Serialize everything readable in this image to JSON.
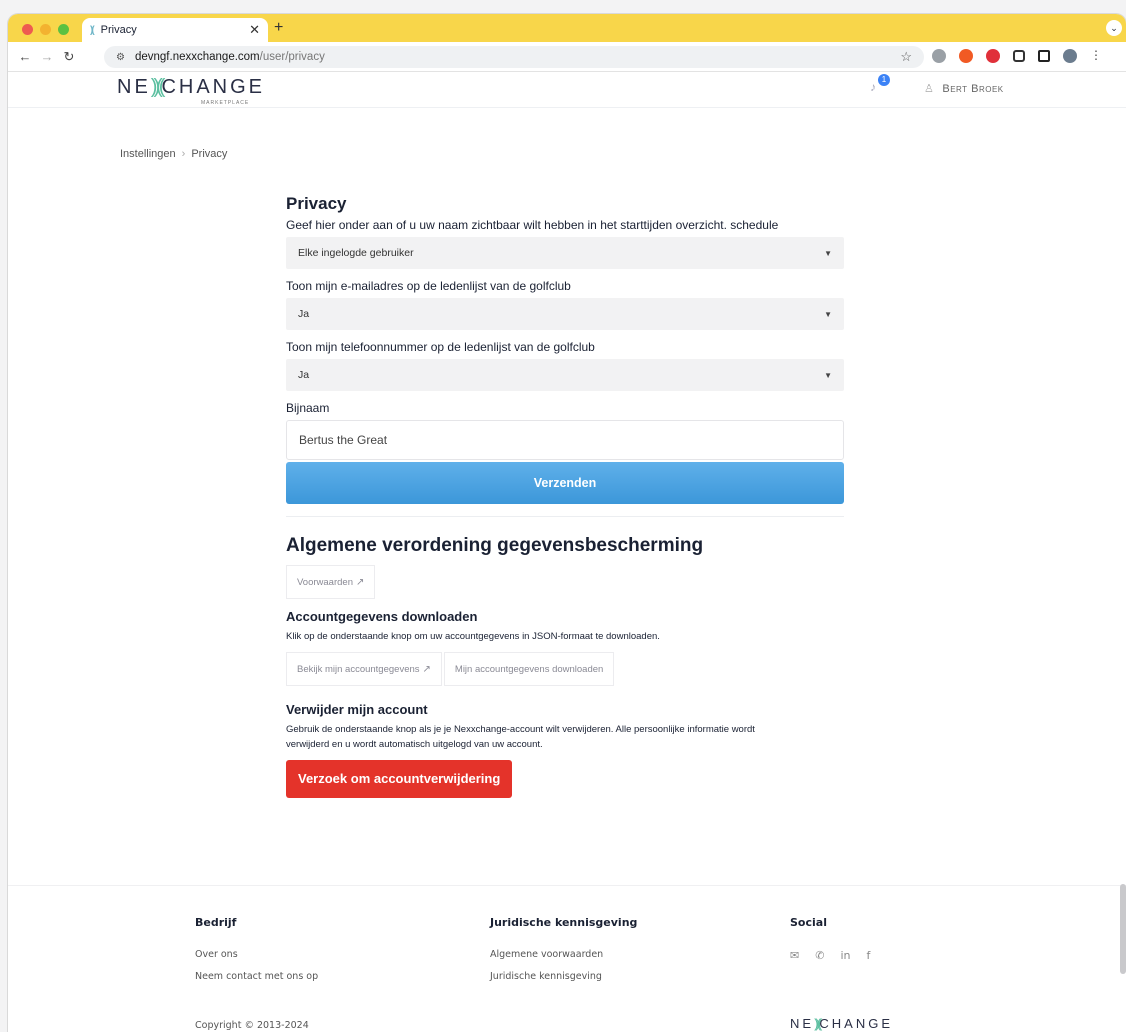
{
  "browser": {
    "tab_title": "Privacy",
    "url_host": "devngf.nexxchange.com",
    "url_path": "/user/privacy"
  },
  "header": {
    "logo_left": "NE",
    "logo_mark": "))((",
    "logo_right": "CHANGE",
    "logo_sub": "MARKETPLACE",
    "notification_count": "1",
    "user_name": "Bert Broek"
  },
  "breadcrumb": {
    "parent": "Instellingen",
    "current": "Privacy"
  },
  "form": {
    "title": "Privacy",
    "name_visibility_label": "Geef hier onder aan of u uw naam zichtbaar wilt hebben in het starttijden overzicht. schedule",
    "name_visibility_value": "Elke ingelogde gebruiker",
    "email_label": "Toon mijn e-mailadres op de ledenlijst van de golfclub",
    "email_value": "Ja",
    "phone_label": "Toon mijn telefoonnummer op de ledenlijst van de golfclub",
    "phone_value": "Ja",
    "nickname_label": "Bijnaam",
    "nickname_value": "Bertus the Great",
    "submit_label": "Verzenden"
  },
  "gdpr": {
    "title": "Algemene verordening gegevensbescherming",
    "terms_button": "Voorwaarden",
    "download_title": "Accountgegevens downloaden",
    "download_desc": "Klik op de onderstaande knop om uw accountgegevens in JSON-formaat te downloaden.",
    "view_button": "Bekijk mijn accountgegevens",
    "download_button": "Mijn accountgegevens downloaden",
    "delete_title": "Verwijder mijn account",
    "delete_desc_1": "Gebruik de onderstaande knop als je je Nexxchange-account wilt verwijderen. Alle persoonlijke informatie wordt",
    "delete_desc_2": "verwijderd en u wordt automatisch uitgelogd van uw account.",
    "delete_button": "Verzoek om accountverwijdering"
  },
  "footer": {
    "col1_title": "Bedrijf",
    "col1_links": [
      "Over ons",
      "Neem contact met ons op"
    ],
    "col2_title": "Juridische kennisgeving",
    "col2_links": [
      "Algemene voorwaarden",
      "Juridische kennisgeving"
    ],
    "col3_title": "Social",
    "social_icons": [
      "mail-icon",
      "phone-icon",
      "linkedin-icon",
      "facebook-icon"
    ],
    "copyright": "Copyright © 2013-2024"
  }
}
